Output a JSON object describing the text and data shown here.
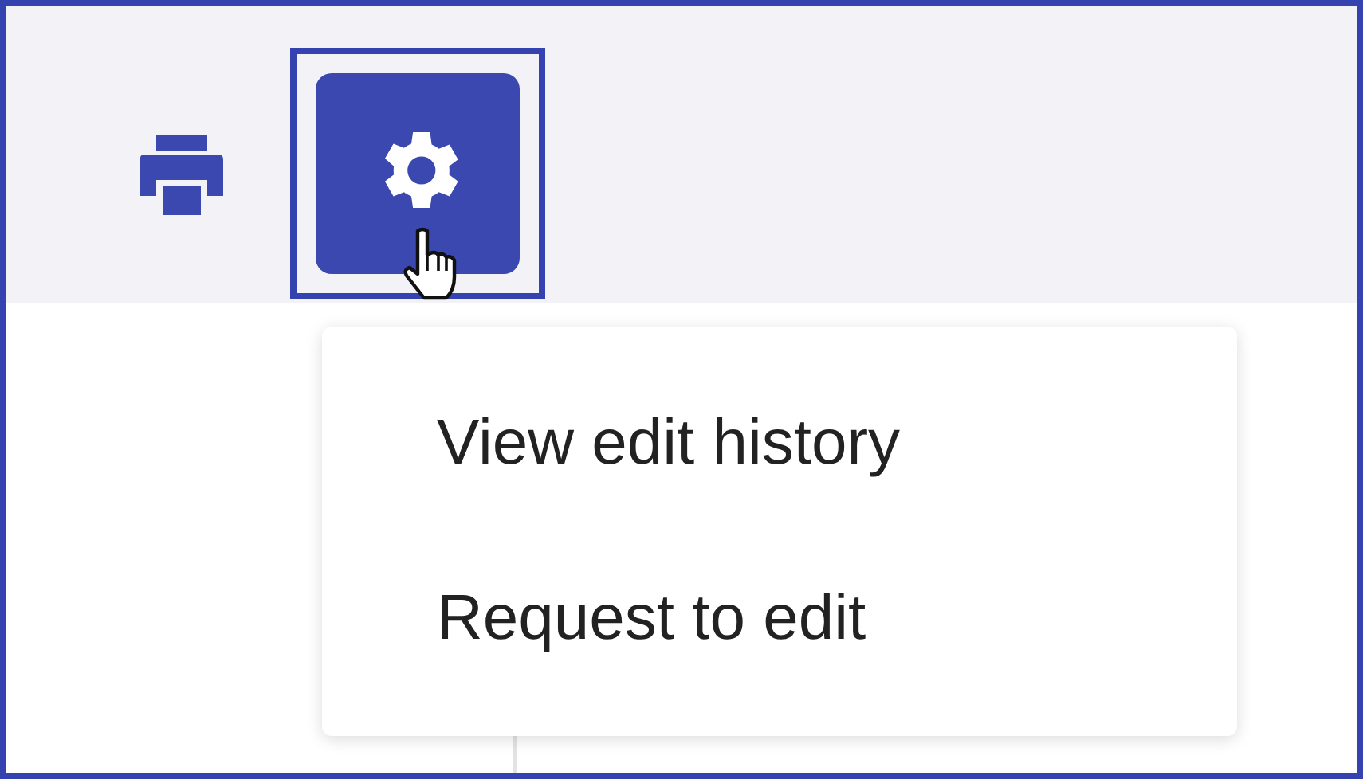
{
  "toolbar": {
    "buttons": [
      {
        "kind": "print",
        "selected": false
      },
      {
        "kind": "settings",
        "selected": true
      }
    ]
  },
  "menu": {
    "items": [
      {
        "label": "View edit history"
      },
      {
        "label": "Request to edit"
      }
    ]
  }
}
